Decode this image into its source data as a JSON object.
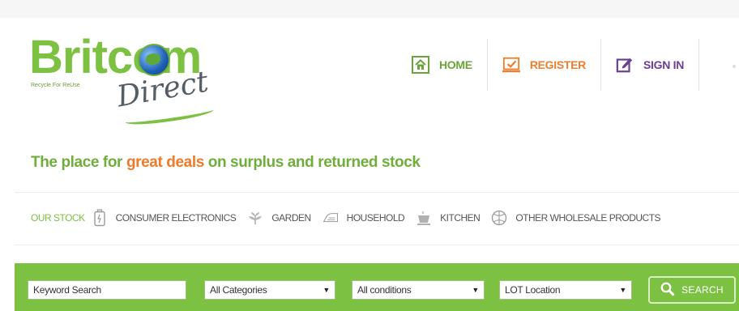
{
  "logo": {
    "name": "Britcom",
    "script": "Direct",
    "tagline": "Recycle For ReUse"
  },
  "nav": {
    "home": "HOME",
    "register": "REGISTER",
    "signin": "SIGN IN"
  },
  "tagline": {
    "part1": "The place for ",
    "accent": "great deals",
    "part2": " on surplus and returned stock"
  },
  "categories": {
    "label": "OUR STOCK",
    "items": [
      {
        "label": "CONSUMER ELECTRONICS",
        "icon": "battery-icon"
      },
      {
        "label": "GARDEN",
        "icon": "plant-icon"
      },
      {
        "label": "HOUSEHOLD",
        "icon": "iron-icon"
      },
      {
        "label": "KITCHEN",
        "icon": "cup-icon"
      },
      {
        "label": "OTHER WHOLESALE PRODUCTS",
        "icon": "ball-icon"
      }
    ]
  },
  "search": {
    "keyword_placeholder": "Keyword Search",
    "category": "All Categories",
    "condition": "All conditions",
    "location": "LOT Location",
    "button": "SEARCH"
  },
  "colors": {
    "brand_green": "#7cc142",
    "accent_orange": "#ef7a2a",
    "signin_purple": "#6a3f94"
  }
}
